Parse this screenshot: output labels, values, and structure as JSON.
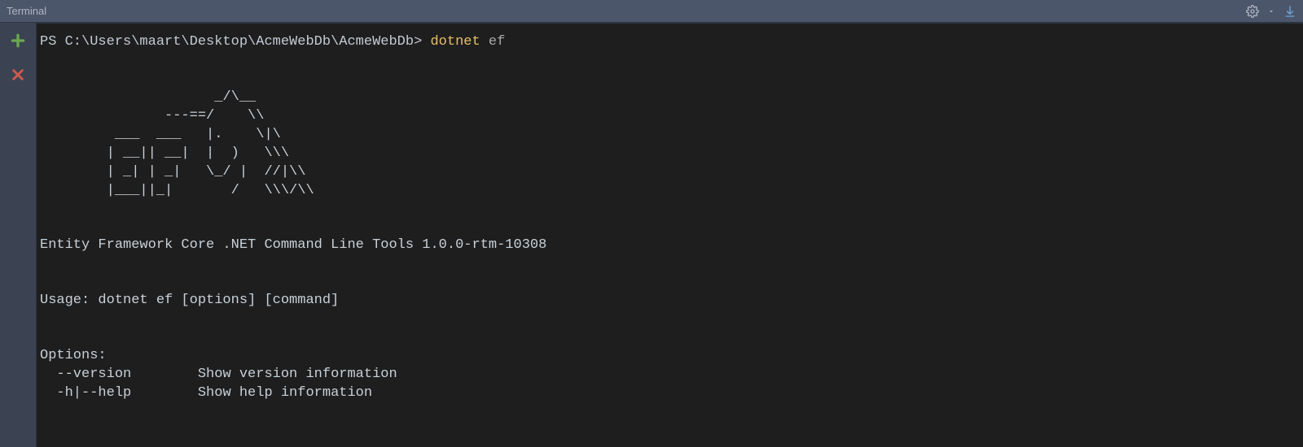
{
  "titlebar": {
    "label": "Terminal"
  },
  "prompt": {
    "prefix": "PS C:\\Users\\maart\\Desktop\\AcmeWebDb\\AcmeWebDb> ",
    "command_main": "dotnet",
    "command_rest": " ef"
  },
  "ascii_art": [
    "                     _/\\__",
    "               ---==/    \\\\",
    "         ___  ___   |.    \\|\\",
    "        | __|| __|  |  )   \\\\\\",
    "        | _| | _|   \\_/ |  //|\\\\",
    "        |___||_|       /   \\\\\\/\\\\"
  ],
  "output": {
    "product_line": "Entity Framework Core .NET Command Line Tools 1.0.0-rtm-10308",
    "usage_line": "Usage: dotnet ef [options] [command]",
    "options_header": "Options:",
    "options": [
      {
        "flag": "  --version       ",
        "desc": " Show version information"
      },
      {
        "flag": "  -h|--help       ",
        "desc": " Show help information"
      }
    ]
  }
}
